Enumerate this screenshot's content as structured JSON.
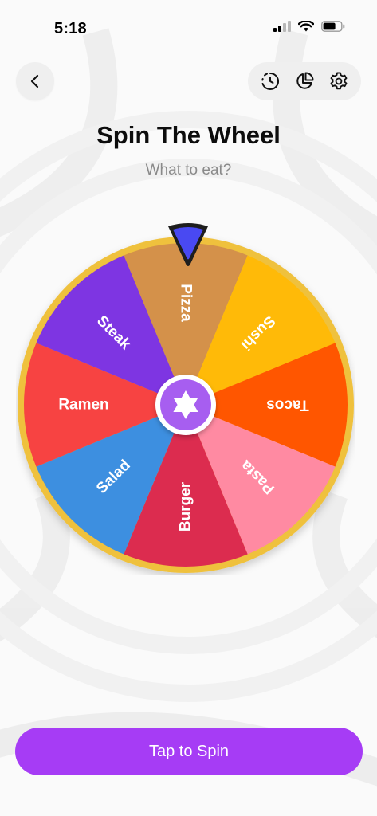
{
  "status_bar": {
    "time": "5:18",
    "icons": [
      "signal-icon",
      "wifi-icon",
      "battery-icon"
    ]
  },
  "header": {
    "back_icon": "chevron-left-icon",
    "actions": [
      {
        "name": "history-icon"
      },
      {
        "name": "pie-chart-icon"
      },
      {
        "name": "gear-icon"
      }
    ]
  },
  "page": {
    "title": "Spin The Wheel",
    "subtitle": "What to eat?"
  },
  "wheel": {
    "segments": [
      {
        "label": "Pizza",
        "color": "#d4914a"
      },
      {
        "label": "Sushi",
        "color": "#ffba08"
      },
      {
        "label": "Tacos",
        "color": "#ff5600"
      },
      {
        "label": "Pasta",
        "color": "#ff8aa2"
      },
      {
        "label": "Burger",
        "color": "#dc2c4f"
      },
      {
        "label": "Salad",
        "color": "#3d8fe0"
      },
      {
        "label": "Ramen",
        "color": "#f74342"
      },
      {
        "label": "Steak",
        "color": "#7e35e2"
      }
    ],
    "rim_color": "#efc13e",
    "hub_color": "#a75ef0",
    "hub_icon": "star-icon",
    "pointer_color": "#4949f2"
  },
  "spin_button": {
    "label": "Tap to Spin",
    "color": "#a63cf5"
  }
}
